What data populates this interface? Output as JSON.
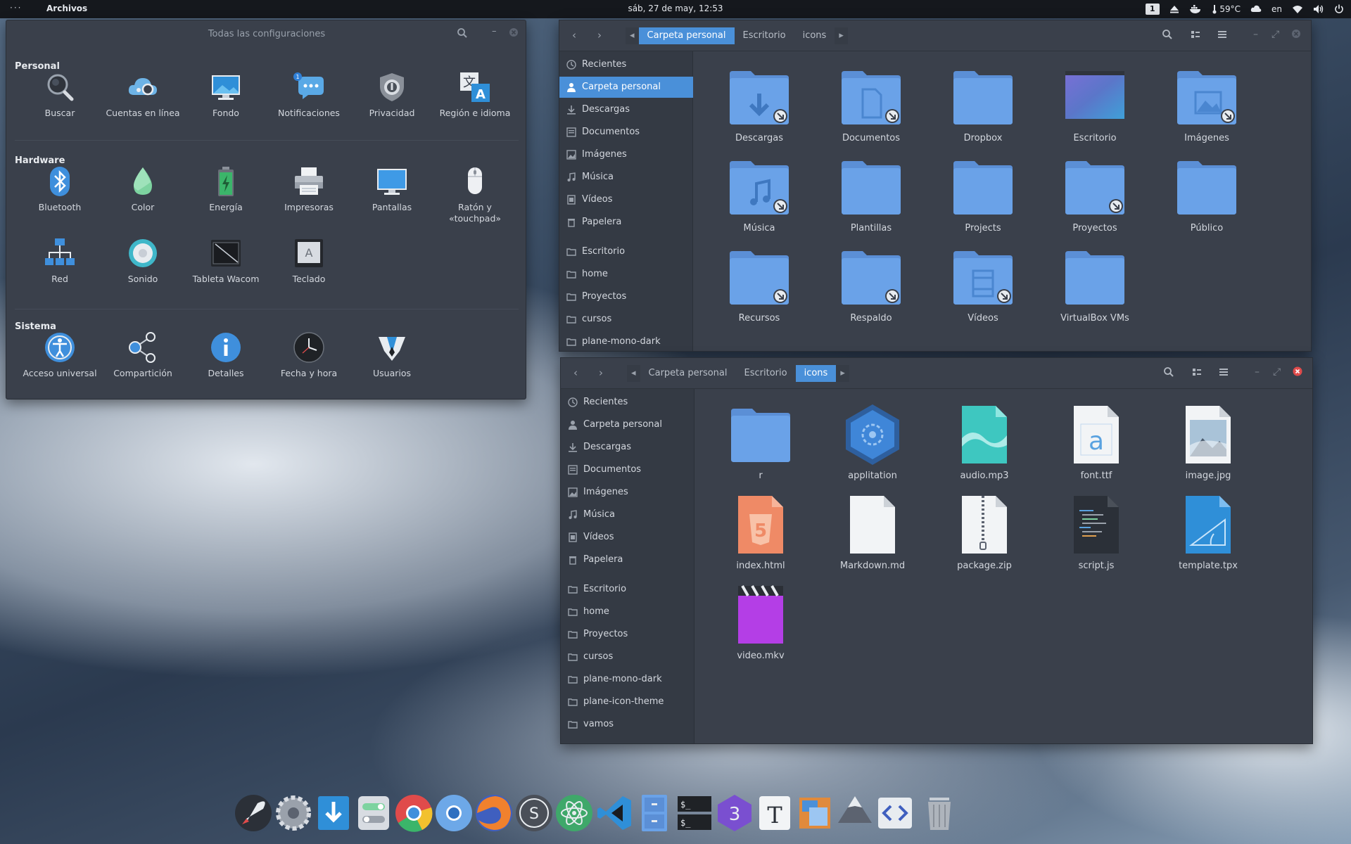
{
  "topbar": {
    "dots": "···",
    "app_name": "Archivos",
    "clock": "sáb, 27 de may, 12:53",
    "workspace": "1",
    "temperature": "59°C",
    "language": "en",
    "icons": [
      "eject-icon",
      "docker-icon",
      "thermometer-icon",
      "cloud-icon",
      "wifi-icon",
      "volume-icon",
      "power-icon"
    ]
  },
  "settings": {
    "title": "Todas las configuraciones",
    "sections": [
      {
        "label": "Personal",
        "items": [
          {
            "label": "Buscar",
            "icon": "search-settings-icon"
          },
          {
            "label": "Cuentas en línea",
            "icon": "online-accounts-icon"
          },
          {
            "label": "Fondo",
            "icon": "background-icon"
          },
          {
            "label": "Notificaciones",
            "icon": "notifications-icon"
          },
          {
            "label": "Privacidad",
            "icon": "privacy-icon"
          },
          {
            "label": "Región e idioma",
            "icon": "region-language-icon"
          }
        ]
      },
      {
        "label": "Hardware",
        "items": [
          {
            "label": "Bluetooth",
            "icon": "bluetooth-icon"
          },
          {
            "label": "Color",
            "icon": "color-icon"
          },
          {
            "label": "Energía",
            "icon": "power-settings-icon"
          },
          {
            "label": "Impresoras",
            "icon": "printer-icon"
          },
          {
            "label": "Pantallas",
            "icon": "displays-icon"
          },
          {
            "label": "Ratón y «touchpad»",
            "icon": "mouse-icon"
          },
          {
            "label": "Red",
            "icon": "network-icon"
          },
          {
            "label": "Sonido",
            "icon": "sound-icon"
          },
          {
            "label": "Tableta Wacom",
            "icon": "wacom-icon"
          },
          {
            "label": "Teclado",
            "icon": "keyboard-icon"
          }
        ]
      },
      {
        "label": "Sistema",
        "items": [
          {
            "label": "Acceso universal",
            "icon": "accessibility-icon"
          },
          {
            "label": "Compartición",
            "icon": "sharing-icon"
          },
          {
            "label": "Detalles",
            "icon": "details-icon"
          },
          {
            "label": "Fecha y hora",
            "icon": "clock-icon"
          },
          {
            "label": "Usuarios",
            "icon": "users-icon"
          }
        ]
      }
    ]
  },
  "files_top": {
    "crumbs": [
      "Carpeta personal",
      "Escritorio",
      "icons"
    ],
    "active_crumb": 0,
    "sidebar": [
      "Recientes",
      "Carpeta personal",
      "Descargas",
      "Documentos",
      "Imágenes",
      "Música",
      "Vídeos",
      "Papelera",
      "Escritorio",
      "home",
      "Proyectos",
      "cursos",
      "plane-mono-dark"
    ],
    "selected": 1,
    "items": [
      {
        "name": "Descargas",
        "kind": "folder",
        "link": true,
        "glyph": "download"
      },
      {
        "name": "Documentos",
        "kind": "folder",
        "link": true,
        "glyph": "document"
      },
      {
        "name": "Dropbox",
        "kind": "folder",
        "link": false,
        "glyph": ""
      },
      {
        "name": "Escritorio",
        "kind": "desktop",
        "link": false,
        "glyph": ""
      },
      {
        "name": "Imágenes",
        "kind": "folder",
        "link": true,
        "glyph": "image"
      },
      {
        "name": "Música",
        "kind": "folder",
        "link": true,
        "glyph": "music"
      },
      {
        "name": "Plantillas",
        "kind": "folder",
        "link": false,
        "glyph": ""
      },
      {
        "name": "Projects",
        "kind": "folder",
        "link": false,
        "glyph": ""
      },
      {
        "name": "Proyectos",
        "kind": "folder",
        "link": true,
        "glyph": ""
      },
      {
        "name": "Público",
        "kind": "folder",
        "link": false,
        "glyph": ""
      },
      {
        "name": "Recursos",
        "kind": "folder",
        "link": true,
        "glyph": ""
      },
      {
        "name": "Respaldo",
        "kind": "folder",
        "link": true,
        "glyph": ""
      },
      {
        "name": "Vídeos",
        "kind": "folder",
        "link": true,
        "glyph": "video"
      },
      {
        "name": "VirtualBox VMs",
        "kind": "folder",
        "link": false,
        "glyph": ""
      }
    ]
  },
  "files_bottom": {
    "crumbs": [
      "Carpeta personal",
      "Escritorio",
      "icons"
    ],
    "active_crumb": 2,
    "sidebar": [
      "Recientes",
      "Carpeta personal",
      "Descargas",
      "Documentos",
      "Imágenes",
      "Música",
      "Vídeos",
      "Papelera",
      "Escritorio",
      "home",
      "Proyectos",
      "cursos",
      "plane-mono-dark",
      "plane-icon-theme",
      "vamos"
    ],
    "selected": -1,
    "items": [
      {
        "name": "r",
        "kind": "folder"
      },
      {
        "name": "applitation",
        "kind": "app"
      },
      {
        "name": "audio.mp3",
        "kind": "audio"
      },
      {
        "name": "font.ttf",
        "kind": "font"
      },
      {
        "name": "image.jpg",
        "kind": "image"
      },
      {
        "name": "index.html",
        "kind": "html"
      },
      {
        "name": "Markdown.md",
        "kind": "text"
      },
      {
        "name": "package.zip",
        "kind": "zip"
      },
      {
        "name": "script.js",
        "kind": "script"
      },
      {
        "name": "template.tpx",
        "kind": "template"
      },
      {
        "name": "video.mkv",
        "kind": "video"
      }
    ]
  },
  "dock": [
    {
      "app": "rocket-launcher-icon"
    },
    {
      "app": "settings-gear-icon"
    },
    {
      "app": "downloader-icon"
    },
    {
      "app": "tweaks-icon"
    },
    {
      "app": "chrome-icon"
    },
    {
      "app": "chromium-icon"
    },
    {
      "app": "firefox-icon"
    },
    {
      "app": "sublime-icon"
    },
    {
      "app": "atom-icon"
    },
    {
      "app": "vscode-icon"
    },
    {
      "app": "file-cabinet-icon"
    },
    {
      "app": "terminal-icon"
    },
    {
      "app": "blender-icon"
    },
    {
      "app": "typora-icon"
    },
    {
      "app": "screenshot-icon"
    },
    {
      "app": "inkscape-icon"
    },
    {
      "app": "code-editor-icon"
    },
    {
      "app": "trash-icon"
    }
  ],
  "colors": {
    "accent": "#4a90d9",
    "folder": "#6aa2e8",
    "window_bg": "#3a404b",
    "sidebar_bg": "#343a44",
    "close_red": "#e04b4b"
  }
}
